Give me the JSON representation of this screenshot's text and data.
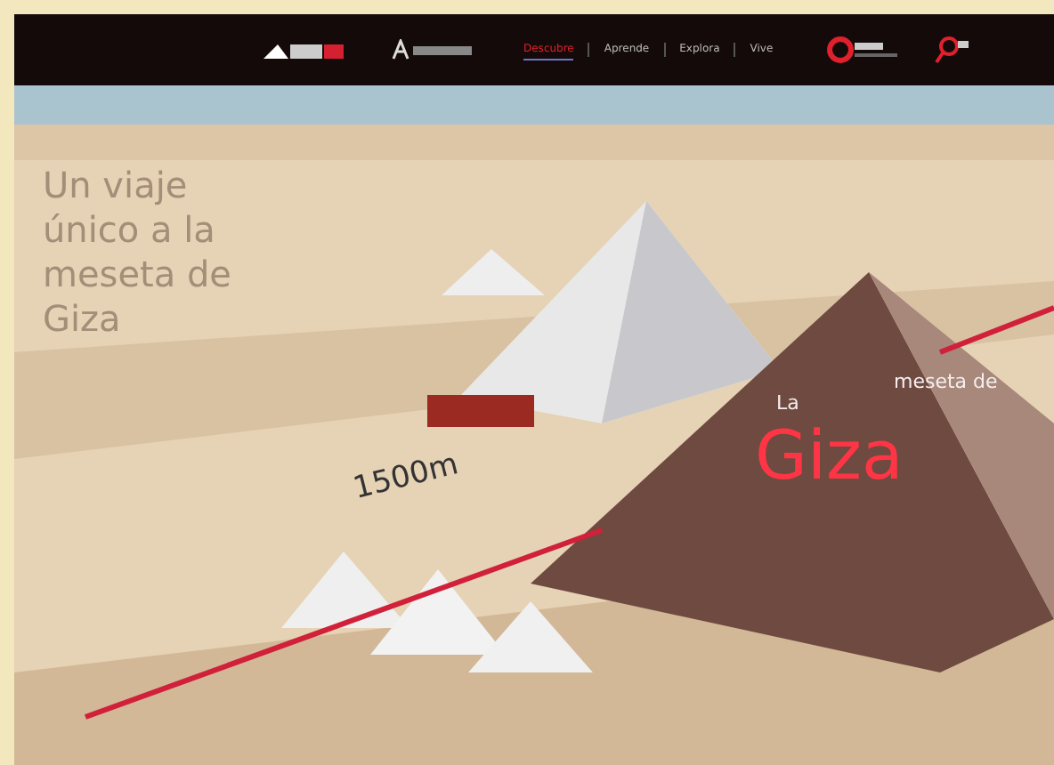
{
  "nav": {
    "items": [
      {
        "label": "Descubre",
        "selected": true
      },
      {
        "label": "Aprende",
        "selected": false
      },
      {
        "label": "Explora",
        "selected": false
      },
      {
        "label": "Vive",
        "selected": false
      }
    ]
  },
  "hero": {
    "headline": "Un viaje único a la meseta de Giza",
    "kind": "picture",
    "labels": [
      {
        "kind": "small",
        "text": "La"
      },
      {
        "kind": "small",
        "text": "meseta de"
      },
      {
        "kind": "big",
        "text": "Giza"
      },
      {
        "kind": "distance",
        "text": "1500m"
      }
    ]
  }
}
